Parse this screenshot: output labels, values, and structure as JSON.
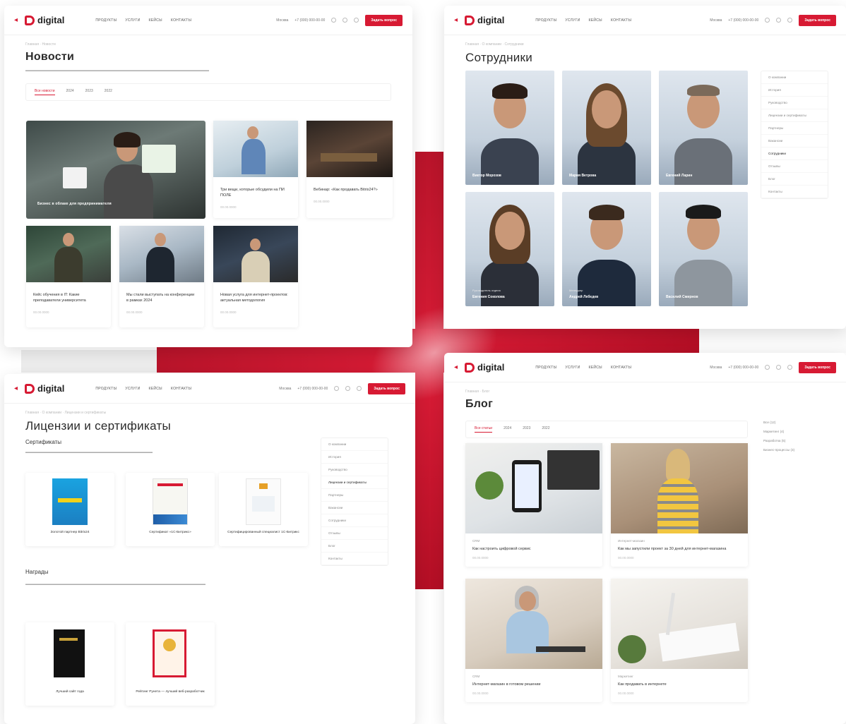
{
  "brand": {
    "logo": "digital",
    "accent": "#d71a33"
  },
  "header": {
    "nav": [
      "Продукты",
      "Услуги",
      "Кейсы",
      "Контакты"
    ],
    "city": "Москва",
    "phone": "+7 (000) 000-00-00",
    "cta": "Задать вопрос"
  },
  "news": {
    "title": "Новости",
    "tabs": [
      "Все новости",
      "2024",
      "2023",
      "2022"
    ],
    "featured": "Бизнес в облаке для предпринимателя",
    "items": [
      {
        "title": "Три вещи, которые обсудили на ПИ ПОЛЕ",
        "date": "00.00.0000"
      },
      {
        "title": "Вебинар: «Как продавать Bitrix24?»",
        "date": "00.00.0000"
      },
      {
        "title": "Кейс обучения в IT: Какие преподаватели университета",
        "date": "00.00.0000"
      },
      {
        "title": "Мы стали выступать на конференции в рамках 2024",
        "date": "00.00.0000"
      },
      {
        "title": "Новая услуга для интернет-проектов: актуальная методология",
        "date": "00.00.0000"
      }
    ]
  },
  "employees": {
    "title": "Сотрудники",
    "people": [
      {
        "name": "Виктор Морозов",
        "role": ""
      },
      {
        "name": "Мария Ветрова",
        "role": ""
      },
      {
        "name": "Евгений Ларин",
        "role": ""
      },
      {
        "name": "Евгения Соколова",
        "role": "Руководитель отдела"
      },
      {
        "name": "Андрей Лебедев",
        "role": "Менеджер"
      },
      {
        "name": "Василий Смирнов",
        "role": ""
      }
    ],
    "sidebar": [
      "О компании",
      "История",
      "Руководство",
      "Лицензии и сертификаты",
      "Партнеры",
      "Вакансии",
      "Сотрудники",
      "Отзывы",
      "Блог",
      "Контакты"
    ],
    "active": "Сотрудники"
  },
  "licenses": {
    "title": "Лицензии и сертификаты",
    "certs_heading": "Сертификаты",
    "certs": [
      "Золотой партнер Bitrix24",
      "Сертификат «1С-Битрикс»",
      "Сертифицированный специалист 1С-Битрикс"
    ],
    "awards_heading": "Награды",
    "awards": [
      "Лучший сайт года",
      "Рейтинг Рунета — лучший веб-разработчик"
    ],
    "sidebar": [
      "О компании",
      "История",
      "Руководство",
      "Лицензии и сертификаты",
      "Партнеры",
      "Вакансии",
      "Сотрудники",
      "Отзывы",
      "Блог",
      "Контакты"
    ],
    "active": "Лицензии и сертификаты"
  },
  "blog": {
    "title": "Блог",
    "tabs": [
      "Все статьи",
      "2024",
      "2023",
      "2022"
    ],
    "sidebar": [
      "Все (12)",
      "Маркетинг (4)",
      "Разработка (5)",
      "Бизнес-процессы (3)"
    ],
    "posts": [
      {
        "tag": "CRM",
        "title": "Как настроить цифровой сервис",
        "date": "00.00.0000"
      },
      {
        "tag": "Интернет-магазин",
        "title": "Как мы запустили проект за 30 дней для интернет-магазина",
        "date": "00.00.0000"
      },
      {
        "tag": "CRM",
        "title": "Интернет-магазин в готовом решении",
        "date": "00.00.0000"
      },
      {
        "tag": "Маркетинг",
        "title": "Как продавать в интернете",
        "date": "00.00.0000"
      }
    ]
  }
}
